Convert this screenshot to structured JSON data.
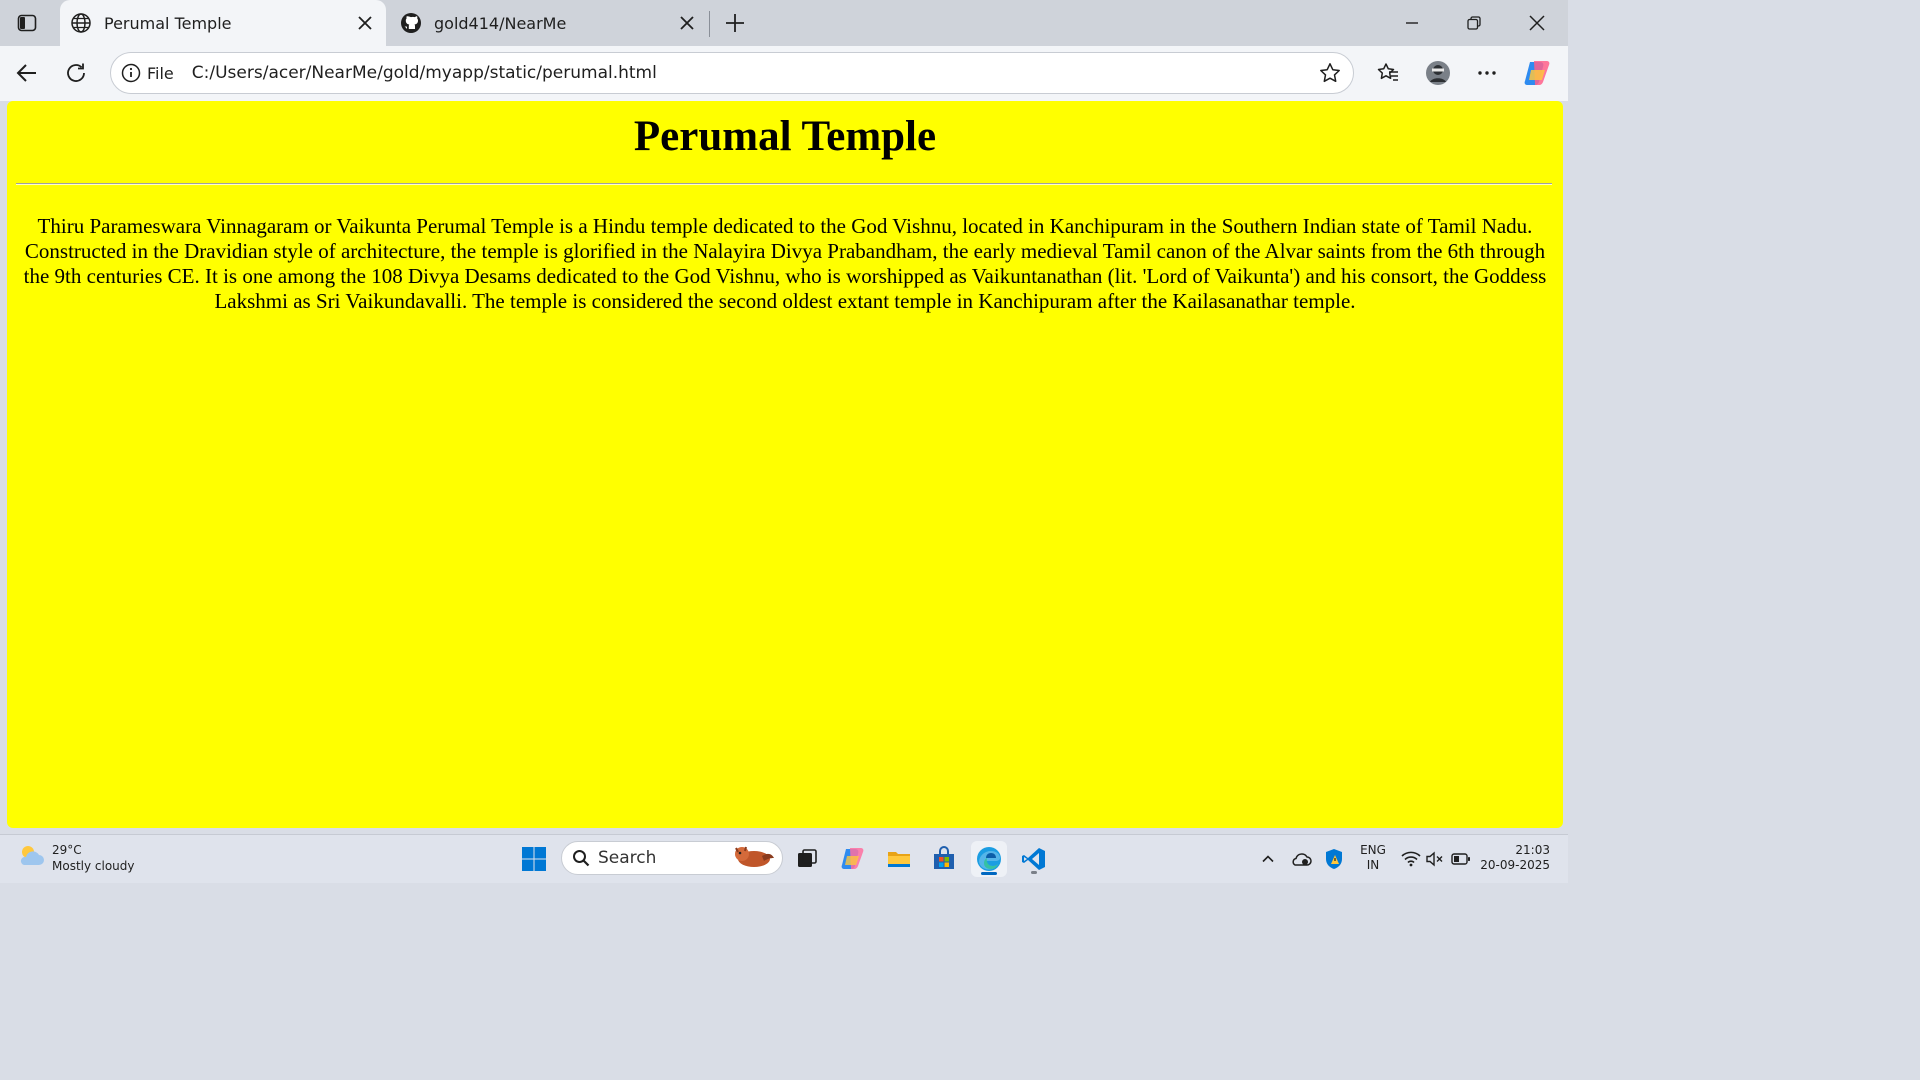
{
  "browser": {
    "tabs": [
      {
        "title": "Perumal Temple",
        "active": true,
        "icon": "globe-icon"
      },
      {
        "title": "gold414/NearMe",
        "active": false,
        "icon": "github-icon"
      }
    ],
    "address": {
      "scheme_label": "File",
      "url": "C:/Users/acer/NearMe/gold/myapp/static/perumal.html"
    }
  },
  "page": {
    "background": "#ffff00",
    "heading": "Perumal Temple",
    "paragraph": "Thiru Parameswara Vinnagaram or Vaikunta Perumal Temple is a Hindu temple dedicated to the God Vishnu, located in Kanchipuram in the Southern Indian state of Tamil Nadu. Constructed in the Dravidian style of architecture, the temple is glorified in the Nalayira Divya Prabandham, the early medieval Tamil canon of the Alvar saints from the 6th through the 9th centuries CE. It is one among the 108 Divya Desams dedicated to the God Vishnu, who is worshipped as Vaikuntanathan (lit. 'Lord of Vaikunta') and his consort, the Goddess Lakshmi as Sri Vaikundavalli. The temple is considered the second oldest extant temple in Kanchipuram after the Kailasanathar temple."
  },
  "taskbar": {
    "weather": {
      "temp": "29°C",
      "condition": "Mostly cloudy"
    },
    "search_label": "Search",
    "language": {
      "line1": "ENG",
      "line2": "IN"
    },
    "clock": {
      "time": "21:03",
      "date": "20-09-2025"
    }
  },
  "colors": {
    "accent": "#0067c0",
    "page_bg": "#ffff00"
  }
}
